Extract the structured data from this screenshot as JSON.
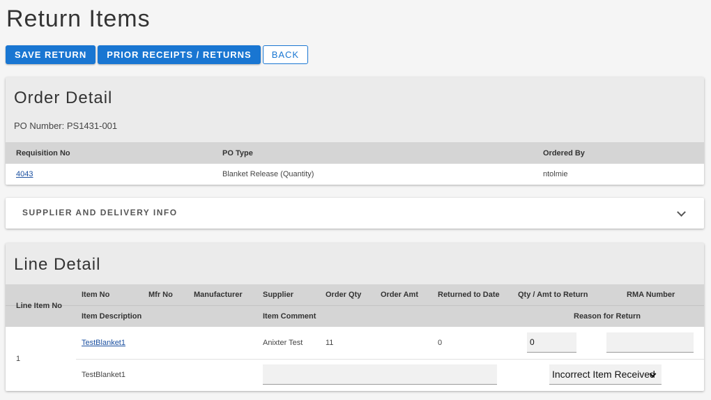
{
  "page": {
    "title": "Return Items"
  },
  "toolbar": {
    "save_label": "SAVE RETURN",
    "prior_label": "PRIOR RECEIPTS / RETURNS",
    "back_label": "BACK"
  },
  "order_detail": {
    "title": "Order Detail",
    "po_number_text": "PO Number: PS1431-001",
    "columns": {
      "requisition_no": "Requisition No",
      "po_type": "PO Type",
      "ordered_by": "Ordered By"
    },
    "row": {
      "requisition_no": "4043",
      "po_type": "Blanket Release (Quantity)",
      "ordered_by": "ntolmie"
    }
  },
  "supplier_section": {
    "title": "SUPPLIER AND DELIVERY INFO"
  },
  "line_detail": {
    "title": "Line Detail",
    "columns": {
      "line_item_no": "Line Item No",
      "item_no": "Item No",
      "mfr_no": "Mfr No",
      "manufacturer": "Manufacturer",
      "supplier": "Supplier",
      "order_qty": "Order Qty",
      "order_amt": "Order Amt",
      "returned_to_date": "Returned to Date",
      "qty_amt_to_return": "Qty / Amt to Return",
      "rma_number": "RMA Number",
      "item_description": "Item Description",
      "item_comment": "Item Comment",
      "reason_for_return": "Reason for Return"
    },
    "row": {
      "line_item_no": "1",
      "item_no": "TestBlanket1",
      "supplier": "Anixter Test",
      "order_qty": "11",
      "returned_to_date": "0",
      "qty_to_return": "0",
      "rma_number": "",
      "item_description": "TestBlanket1",
      "item_comment": "",
      "reason_for_return": "Incorrect Item Received"
    }
  }
}
